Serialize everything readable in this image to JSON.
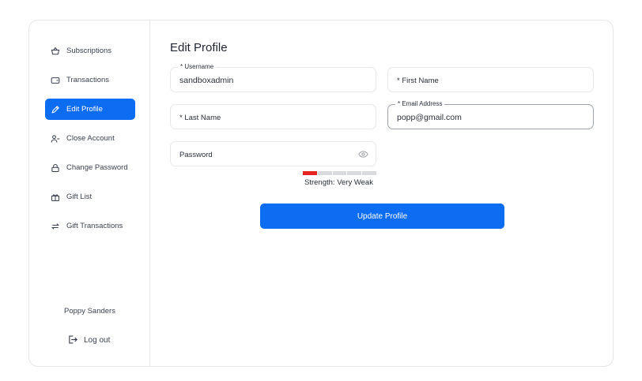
{
  "sidebar": {
    "items": [
      {
        "label": "Subscriptions",
        "icon": "basket-icon",
        "active": false
      },
      {
        "label": "Transactions",
        "icon": "wallet-icon",
        "active": false
      },
      {
        "label": "Edit Profile",
        "icon": "pencil-icon",
        "active": true
      },
      {
        "label": "Close Account",
        "icon": "user-minus-icon",
        "active": false
      },
      {
        "label": "Change Password",
        "icon": "lock-icon",
        "active": false
      },
      {
        "label": "Gift List",
        "icon": "gift-icon",
        "active": false
      },
      {
        "label": "Gift Transactions",
        "icon": "arrows-exchange-icon",
        "active": false
      }
    ],
    "user_name": "Poppy Sanders",
    "logout_label": "Log out"
  },
  "main": {
    "title": "Edit Profile",
    "fields": {
      "username": {
        "label": "* Username",
        "value": "sandboxadmin"
      },
      "first_name": {
        "placeholder": "* First Name"
      },
      "last_name": {
        "placeholder": "* Last Name"
      },
      "email": {
        "label": "* Email Address",
        "value": "popp@gmail.com"
      },
      "password": {
        "placeholder": "Password"
      }
    },
    "strength": {
      "label": "Strength: Very Weak",
      "level": 1,
      "segments": 5
    },
    "update_button": "Update Profile"
  },
  "colors": {
    "accent": "#0c6cf2",
    "strength_weak": "#e82121"
  }
}
